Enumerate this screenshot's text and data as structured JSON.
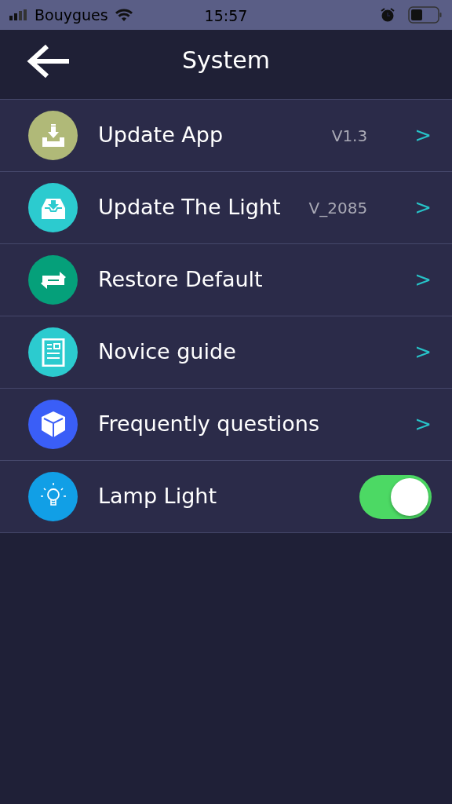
{
  "status_bar": {
    "carrier": "Bouygues",
    "time": "15:57"
  },
  "header": {
    "title": "System"
  },
  "items": [
    {
      "kind": "link",
      "label": "Update App",
      "value": "V1.3",
      "chevron": ">",
      "color": "#b0b978"
    },
    {
      "kind": "link",
      "label": "Update The Light",
      "value": "V_2085",
      "chevron": ">",
      "color": "#2ccbcf"
    },
    {
      "kind": "link",
      "label": "Restore Default",
      "chevron": ">",
      "color": "#05a07a"
    },
    {
      "kind": "link",
      "label": "Novice guide",
      "chevron": ">",
      "color": "#2ccbcf"
    },
    {
      "kind": "link",
      "label": "Frequently questions",
      "chevron": ">",
      "color": "#3a5ef7"
    },
    {
      "kind": "toggle",
      "label": "Lamp Light",
      "on": true,
      "color": "#119fe6"
    }
  ]
}
